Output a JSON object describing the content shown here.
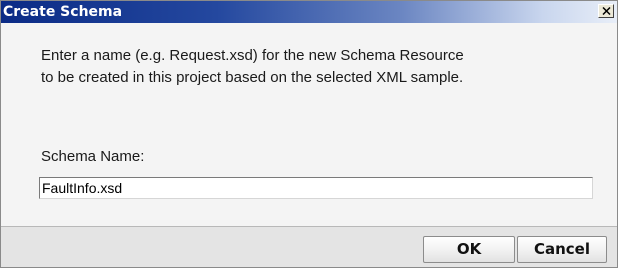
{
  "dialog": {
    "title": "Create Schema",
    "message_line1": "Enter a name (e.g. Request.xsd) for the new Schema Resource",
    "message_line2": "to be created in this project based on the selected XML sample.",
    "schema_name_label": "Schema Name:",
    "schema_name_value": "FaultInfo.xsd",
    "ok_label": "OK",
    "cancel_label": "Cancel"
  },
  "icons": {
    "close": "close-icon"
  },
  "colors": {
    "titlebar_start": "#0b2b86",
    "titlebar_end": "#e8eef8",
    "dialog_background": "#f4f4f4",
    "footer_background": "#e4e4e4"
  }
}
